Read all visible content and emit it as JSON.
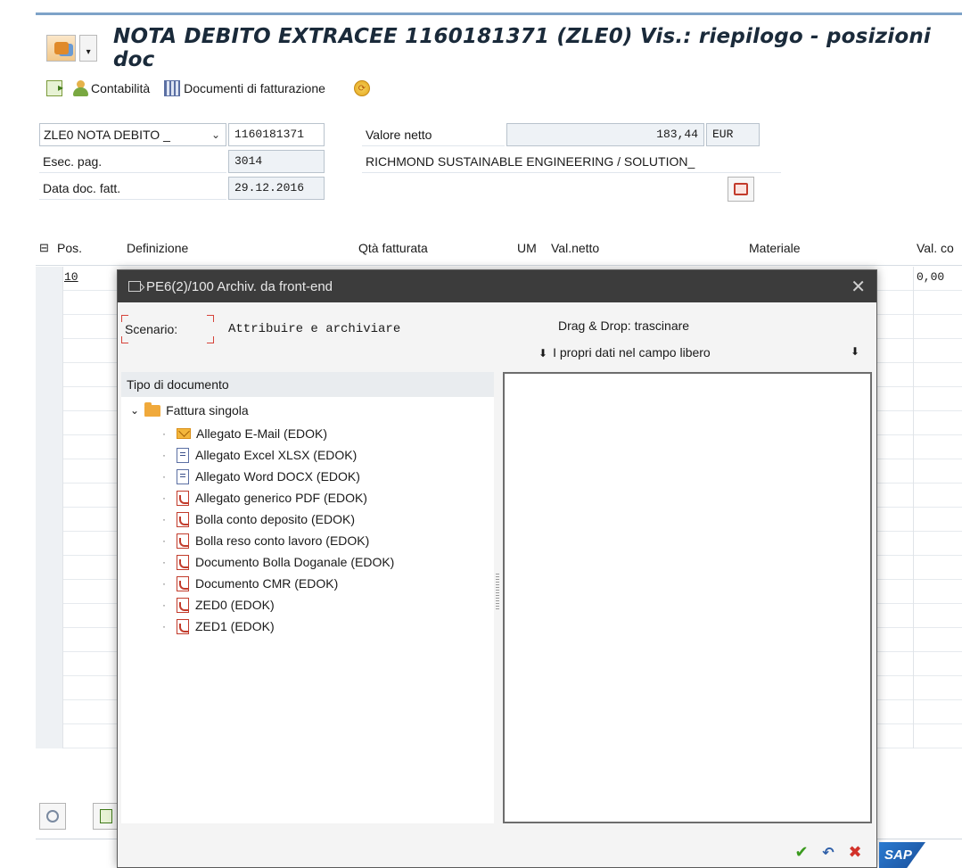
{
  "window": {
    "title": "NOTA DEBITO EXTRACEE 1160181371 (ZLE0) Vis.: riepilogo - posizioni doc"
  },
  "toolbar": {
    "contabilita_label": "Contabilità",
    "documenti_label": "Documenti di fatturazione"
  },
  "header": {
    "doc_type_value": "ZLE0 NOTA DEBITO _",
    "doc_number": "1160181371",
    "valore_netto_label": "Valore netto",
    "valore_netto_value": "183,44",
    "currency": "EUR",
    "esec_pag_label": "Esec. pag.",
    "esec_pag_value": "3014",
    "customer_name": "RICHMOND SUSTAINABLE ENGINEERING / SOLUTION_",
    "data_doc_label": "Data doc. fatt.",
    "data_doc_value": "29.12.2016"
  },
  "table": {
    "columns": [
      "Pos.",
      "Definizione",
      "Qtà fatturata",
      "UM",
      "Val.netto",
      "Materiale",
      "Val. co"
    ],
    "rows": [
      {
        "pos": "10",
        "val_co": "0,00"
      }
    ]
  },
  "dialog": {
    "title": "PE6(2)/100 Archiv. da front-end",
    "scenario_label": "Scenario:",
    "scenario_value": "Attribuire e archiviare",
    "drag_drop_label": "Drag & Drop: trascinare",
    "drop_hint": "I propri dati nel campo libero",
    "tree_header": "Tipo di documento",
    "folder_label": "Fattura singola",
    "items": [
      {
        "label": "Allegato E-Mail (EDOK)",
        "icon": "email-icon"
      },
      {
        "label": "Allegato Excel XLSX (EDOK)",
        "icon": "document-icon"
      },
      {
        "label": "Allegato Word DOCX (EDOK)",
        "icon": "document-icon"
      },
      {
        "label": "Allegato generico PDF (EDOK)",
        "icon": "pdf-icon"
      },
      {
        "label": "Bolla conto deposito (EDOK)",
        "icon": "pdf-icon"
      },
      {
        "label": "Bolla reso conto lavoro (EDOK)",
        "icon": "pdf-icon"
      },
      {
        "label": "Documento Bolla Doganale (EDOK)",
        "icon": "pdf-icon"
      },
      {
        "label": "Documento CMR (EDOK)",
        "icon": "pdf-icon"
      },
      {
        "label": "ZED0 (EDOK)",
        "icon": "pdf-icon"
      },
      {
        "label": "ZED1 (EDOK)",
        "icon": "pdf-icon"
      }
    ]
  },
  "branding": {
    "logo_text": "SAP"
  }
}
